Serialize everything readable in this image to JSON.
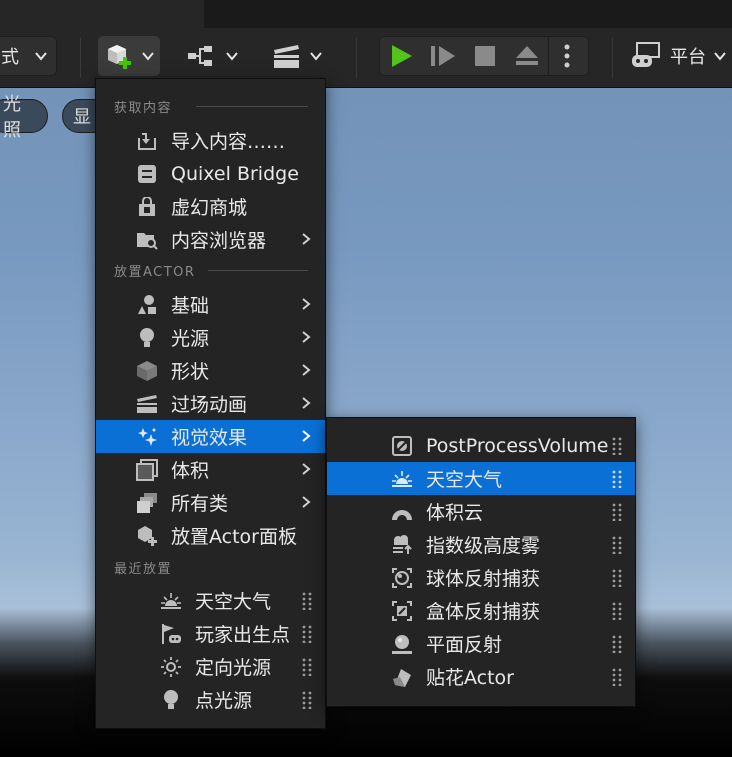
{
  "toolbar": {
    "mode_label": "式",
    "platform_label": "平台"
  },
  "viewport": {
    "chip_lighting": "光照",
    "chip_show": "显"
  },
  "add_menu": {
    "sections": {
      "get_content": "获取内容",
      "place_actor": "放置ACTOR",
      "recent": "最近放置"
    },
    "items": [
      {
        "label": "导入内容……",
        "icon": "import-icon",
        "submenu": false
      },
      {
        "label": "Quixel Bridge",
        "icon": "quixel-bridge-icon",
        "submenu": false
      },
      {
        "label": "虚幻商城",
        "icon": "marketplace-icon",
        "submenu": false
      },
      {
        "label": "内容浏览器",
        "icon": "content-browser-icon",
        "submenu": true
      },
      {
        "label": "基础",
        "icon": "basic-icon",
        "submenu": true
      },
      {
        "label": "光源",
        "icon": "light-bulb-icon",
        "submenu": true
      },
      {
        "label": "形状",
        "icon": "cube-icon",
        "submenu": true
      },
      {
        "label": "过场动画",
        "icon": "clapperboard-icon",
        "submenu": true
      },
      {
        "label": "视觉效果",
        "icon": "sparkles-icon",
        "submenu": true,
        "active": true
      },
      {
        "label": "体积",
        "icon": "volume-icon",
        "submenu": true
      },
      {
        "label": "所有类",
        "icon": "all-classes-icon",
        "submenu": true
      },
      {
        "label": "放置Actor面板",
        "icon": "place-actor-icon",
        "submenu": false
      }
    ],
    "recent": [
      {
        "label": "天空大气",
        "icon": "sky-atmosphere-icon"
      },
      {
        "label": "玩家出生点",
        "icon": "player-start-icon"
      },
      {
        "label": "定向光源",
        "icon": "directional-light-icon"
      },
      {
        "label": "点光源",
        "icon": "point-light-icon"
      }
    ]
  },
  "visual_effects_menu": {
    "items": [
      {
        "label": "PostProcessVolume",
        "icon": "post-process-icon"
      },
      {
        "label": "天空大气",
        "icon": "sky-atmosphere-icon",
        "active": true
      },
      {
        "label": "体积云",
        "icon": "volumetric-cloud-icon"
      },
      {
        "label": "指数级高度雾",
        "icon": "height-fog-icon"
      },
      {
        "label": "球体反射捕获",
        "icon": "sphere-reflection-icon"
      },
      {
        "label": "盒体反射捕获",
        "icon": "box-reflection-icon"
      },
      {
        "label": "平面反射",
        "icon": "planar-reflection-icon"
      },
      {
        "label": "贴花Actor",
        "icon": "decal-icon"
      }
    ]
  },
  "colors": {
    "accent": "#0a70d6",
    "play_green": "#52c41a",
    "add_green": "#45c400",
    "menu_bg": "#242424"
  }
}
